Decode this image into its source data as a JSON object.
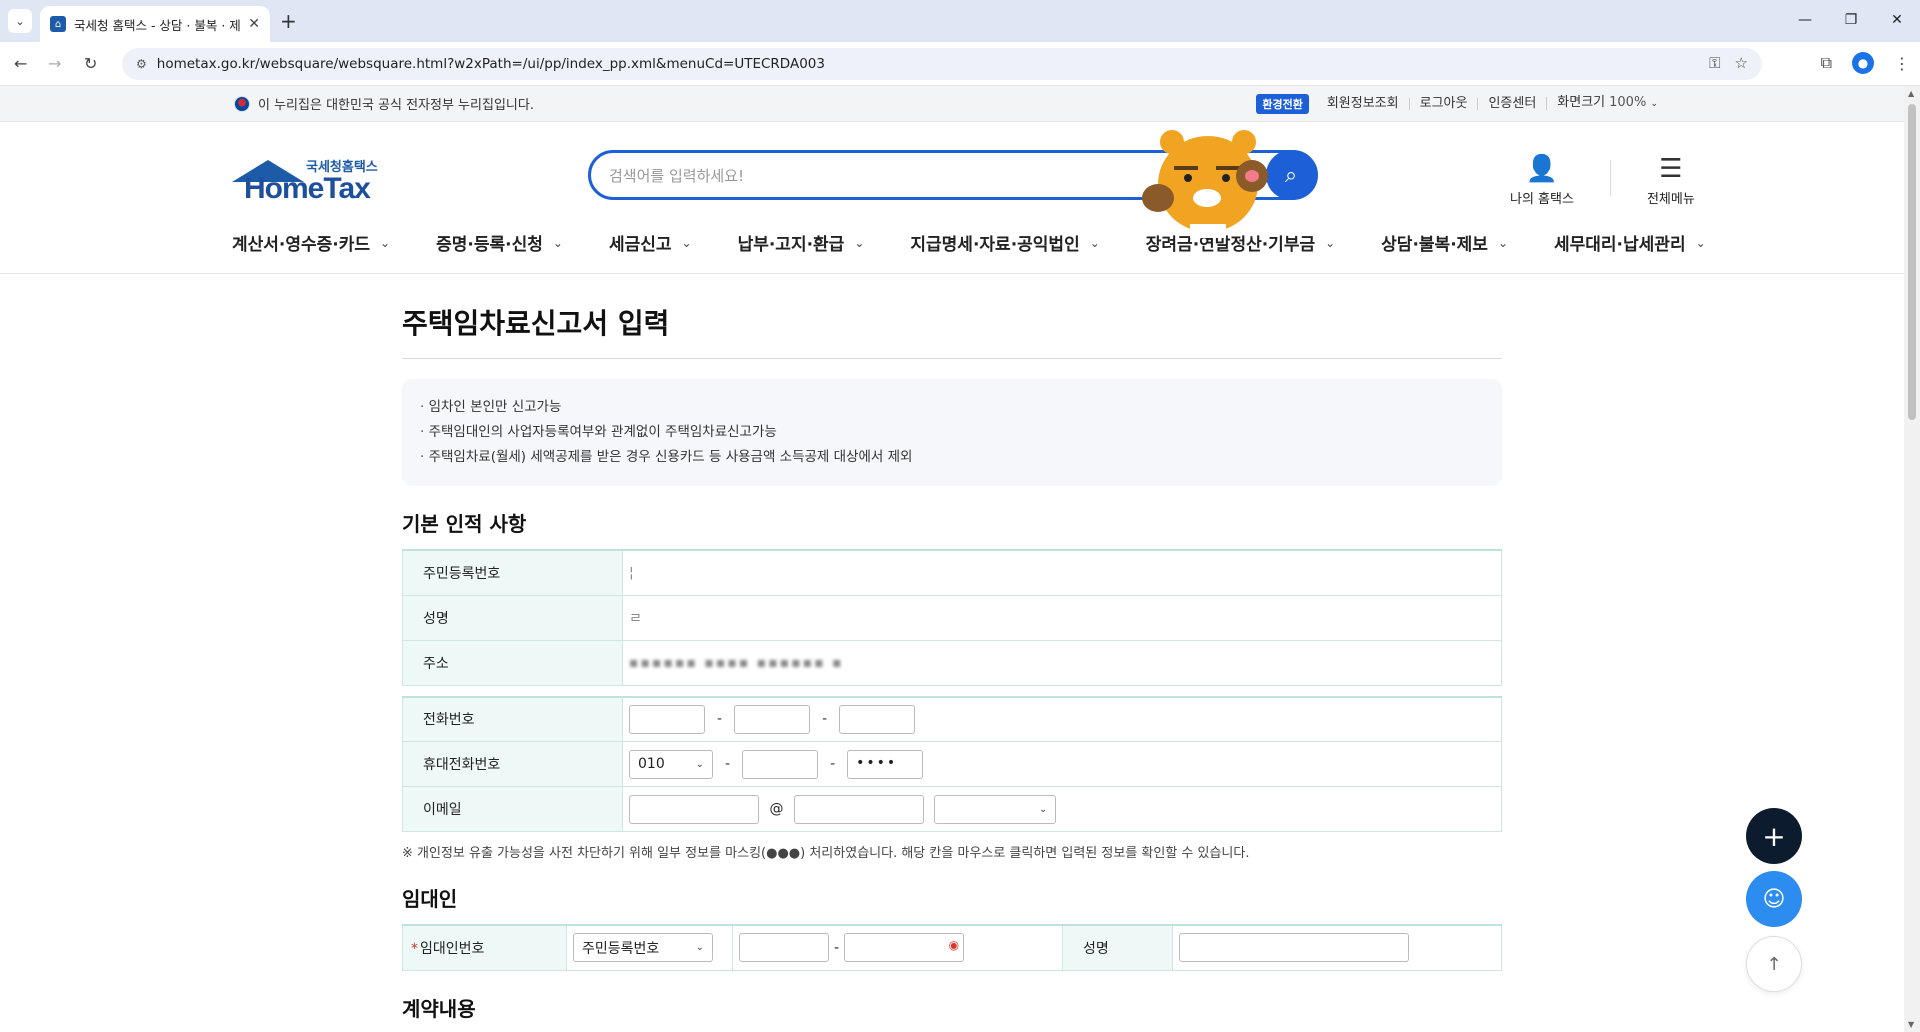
{
  "browser": {
    "tab_title": "국세청 홈택스 - 상담 · 불복 · 제보",
    "url": "hometax.go.kr/websquare/websquare.html?w2xPath=/ui/pp/index_pp.xml&menuCd=UTECRDA003"
  },
  "gov_strip": {
    "text": "이 누리집은 대한민국 공식 전자정부 누리집입니다.",
    "badge": "환경전환",
    "links": [
      "회원정보조회",
      "로그아웃",
      "인증센터",
      "화면크기"
    ],
    "zoom": "100%"
  },
  "header": {
    "logo_small": "국세청홈택스",
    "logo_big": "HomeTax",
    "search_placeholder": "검색어를 입력하세요!",
    "my_hometax": "나의 홈택스",
    "all_menu": "전체메뉴"
  },
  "gnb": [
    "계산서·영수증·카드",
    "증명·등록·신청",
    "세금신고",
    "납부·고지·환급",
    "지급명세·자료·공익법인",
    "장려금·연말정산·기부금",
    "상담·불복·제보",
    "세무대리·납세관리"
  ],
  "page": {
    "title": "주택임차료신고서 입력",
    "notices": [
      "임차인 본인만 신고가능",
      "주택임대인의 사업자등록여부와 관계없이 주택임차료신고가능",
      "주택임차료(월세) 세액공제를 받은 경우 신용카드 등 사용금액 소득공제 대상에서 제외"
    ],
    "section_basic": "기본 인적 사항",
    "basic": {
      "rrn_label": "주민등록번호",
      "name_label": "성명",
      "address_label": "주소"
    },
    "contact": {
      "phone_label": "전화번호",
      "mobile_label": "휴대전화번호",
      "mobile_prefix": "010",
      "mobile_last": "••••",
      "email_label": "이메일",
      "at": "@"
    },
    "privacy_note": "※ 개인정보 유출 가능성을 사전 차단하기 위해 일부 정보를 마스킹(●●●) 처리하였습니다. 해당 칸을 마우스로 클릭하면 입력된 정보를 확인할 수 있습니다.",
    "section_landlord": "임대인",
    "landlord": {
      "id_label": "임대인번호",
      "id_type": "주민등록번호",
      "name_label": "성명"
    },
    "section_contract": "계약내용"
  }
}
